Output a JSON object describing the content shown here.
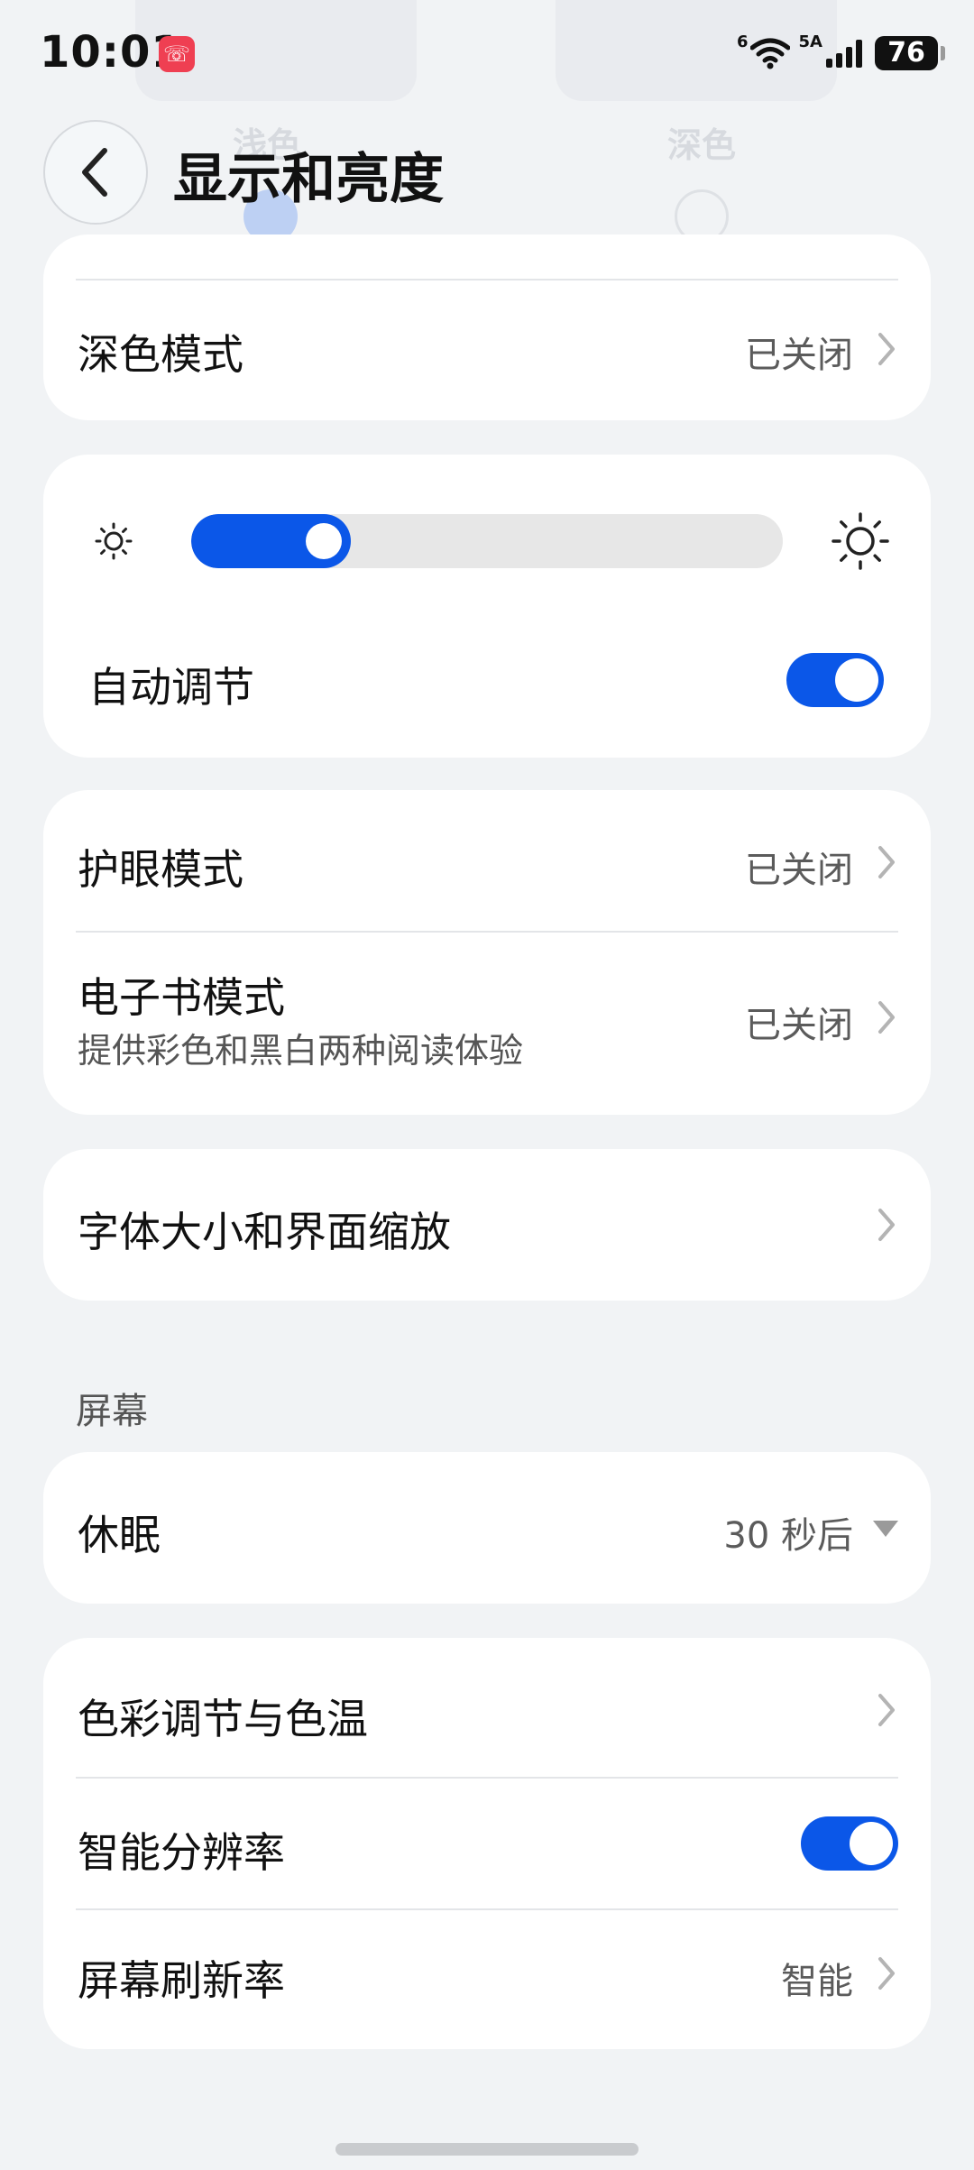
{
  "status_bar": {
    "time": "10:01",
    "network_label": "6",
    "network_label_2": "5A",
    "battery": "76"
  },
  "background": {
    "theme_light_label": "浅色",
    "theme_dark_label": "深色"
  },
  "header": {
    "title": "显示和亮度"
  },
  "dark_mode": {
    "label": "深色模式",
    "value": "已关闭"
  },
  "brightness": {
    "level_percent": 24,
    "auto_label": "自动调节",
    "auto_enabled": true
  },
  "eye_care": {
    "label": "护眼模式",
    "value": "已关闭"
  },
  "ebook": {
    "label": "电子书模式",
    "subtitle": "提供彩色和黑白两种阅读体验",
    "value": "已关闭"
  },
  "font_size": {
    "label": "字体大小和界面缩放"
  },
  "screen_section": {
    "title": "屏幕"
  },
  "sleep": {
    "label": "休眠",
    "value": "30 秒后"
  },
  "color_adjust": {
    "label": "色彩调节与色温"
  },
  "smart_resolution": {
    "label": "智能分辨率",
    "enabled": true
  },
  "refresh_rate": {
    "label": "屏幕刷新率",
    "value": "智能"
  },
  "colors": {
    "accent": "#0b57e8",
    "notification": "#ef3f52"
  }
}
